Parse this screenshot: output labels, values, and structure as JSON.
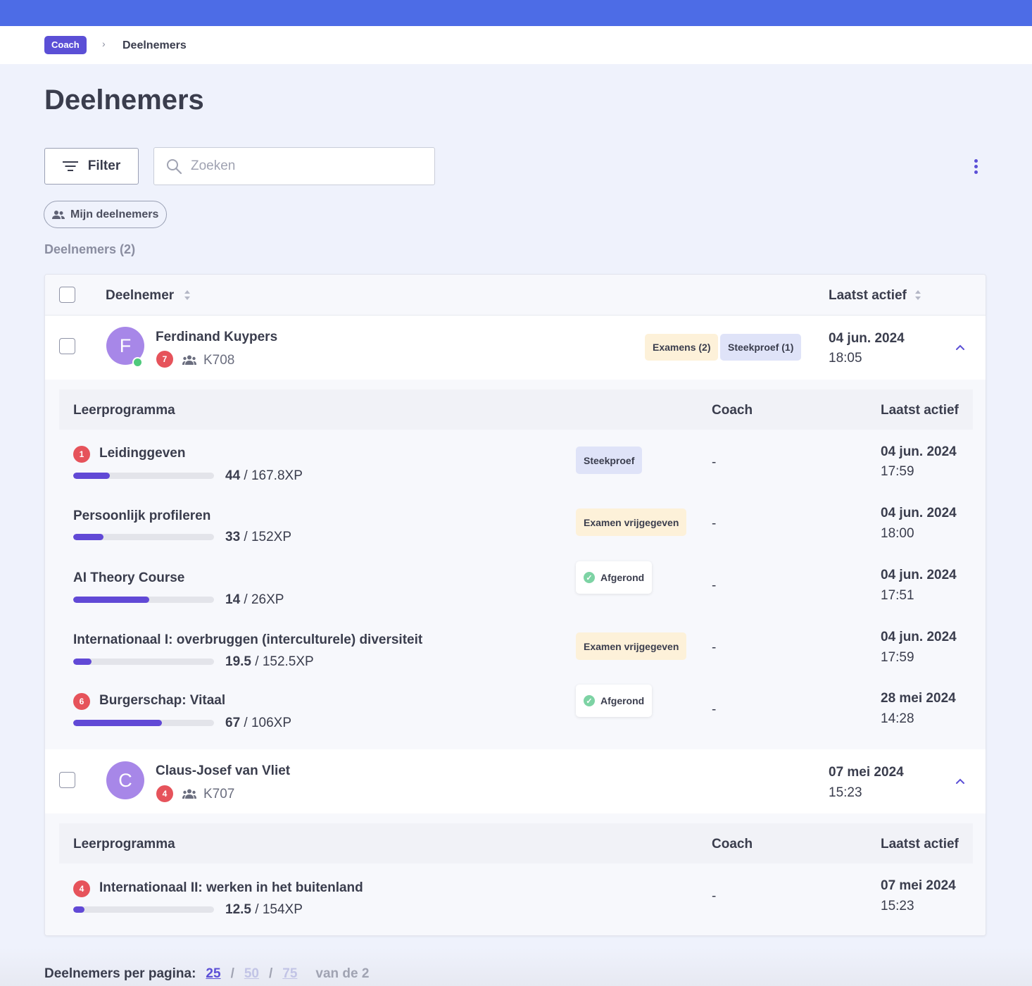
{
  "breadcrumb": {
    "root": "Coach",
    "separator": "›",
    "current": "Deelnemers"
  },
  "page": {
    "title": "Deelnemers"
  },
  "toolbar": {
    "filter_label": "Filter",
    "filter_icon": "filter-lines-icon",
    "search_placeholder": "Zoeken",
    "search_value": "",
    "search_icon": "search-icon",
    "more_icon": "more-vertical-icon"
  },
  "chip": {
    "label": "Mijn deelnemers",
    "icon": "people-icon"
  },
  "count_label": "Deelnemers (2)",
  "table": {
    "headers": {
      "participant": "Deelnemer",
      "last_active": "Laatst actief"
    },
    "sub_headers": {
      "program": "Leerprogramma",
      "coach": "Coach",
      "last_active": "Laatst actief"
    }
  },
  "participants": [
    {
      "initial": "F",
      "name": "Ferdinand Kuypers",
      "online": true,
      "badge": "7",
      "code": "K708",
      "tags": [
        "Examens (2)",
        "Steekproef (1)"
      ],
      "date": "04 jun. 2024",
      "time": "18:05",
      "programs": [
        {
          "badge": "1",
          "title": "Leidinggeven",
          "xp_current": "44",
          "xp_total": " / 167.8XP",
          "progress": 0.262,
          "status": "Steekproef",
          "status_style": "blue",
          "coach": "-",
          "date": "04 jun. 2024",
          "time": "17:59"
        },
        {
          "badge": "",
          "title": "Persoonlijk profileren",
          "xp_current": "33",
          "xp_total": " / 152XP",
          "progress": 0.217,
          "status": "Examen vrijgegeven",
          "status_style": "yellow",
          "coach": "-",
          "date": "04 jun. 2024",
          "time": "18:00"
        },
        {
          "badge": "",
          "title": "AI Theory Course",
          "xp_current": "14",
          "xp_total": " / 26XP",
          "progress": 0.538,
          "status": "Afgerond",
          "status_style": "white",
          "coach": "-",
          "date": "04 jun. 2024",
          "time": "17:51"
        },
        {
          "badge": "",
          "title": "Internationaal I: overbruggen (interculturele) diversiteit",
          "xp_current": "19.5",
          "xp_total": " / 152.5XP",
          "progress": 0.128,
          "status": "Examen vrijgegeven",
          "status_style": "yellow",
          "coach": "-",
          "date": "04 jun. 2024",
          "time": "17:59"
        },
        {
          "badge": "6",
          "title": "Burgerschap: Vitaal",
          "xp_current": "67",
          "xp_total": " / 106XP",
          "progress": 0.632,
          "status": "Afgerond",
          "status_style": "white",
          "coach": "-",
          "date": "28 mei 2024",
          "time": "14:28"
        }
      ]
    },
    {
      "initial": "C",
      "name": "Claus-Josef van Vliet",
      "online": false,
      "badge": "4",
      "code": "K707",
      "tags": [],
      "date": "07 mei 2024",
      "time": "15:23",
      "programs": [
        {
          "badge": "4",
          "title": "Internationaal II: werken in het buitenland",
          "xp_current": "12.5",
          "xp_total": " / 154XP",
          "progress": 0.081,
          "status": "",
          "status_style": "",
          "coach": "-",
          "date": "07 mei 2024",
          "time": "15:23"
        }
      ]
    }
  ],
  "pagination": {
    "label": "Deelnemers per pagina:",
    "options": [
      "25",
      "50",
      "75"
    ],
    "selected": "25",
    "separator": "/",
    "total": "van de 2"
  },
  "colors": {
    "header_bar": "#4d6ce6",
    "accent": "#5b4fd6",
    "progress": "#6149d6",
    "badge_red": "#e6535b",
    "online": "#4fca7c",
    "tag_yellow": "#fdf1d9",
    "tag_blue": "#dfe3f8"
  }
}
